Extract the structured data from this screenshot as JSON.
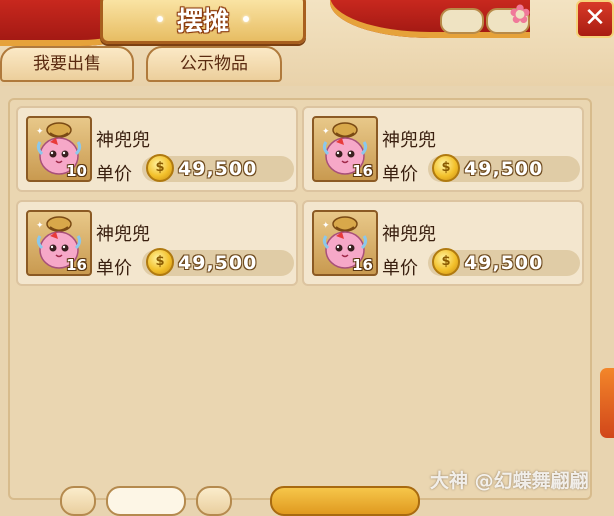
{
  "window": {
    "title": "摆摊",
    "close_icon": "close-icon",
    "accent_color": "#c8281e"
  },
  "tabs": [
    {
      "label": "我要出售"
    },
    {
      "label": "公示物品"
    }
  ],
  "items": [
    {
      "name": "神兜兜",
      "price_label": "单价",
      "price": "49,500",
      "count": "10",
      "icon": "bag-pet-icon"
    },
    {
      "name": "神兜兜",
      "price_label": "单价",
      "price": "49,500",
      "count": "16",
      "icon": "bag-pet-icon"
    },
    {
      "name": "神兜兜",
      "price_label": "单价",
      "price": "49,500",
      "count": "16",
      "icon": "bag-pet-icon"
    },
    {
      "name": "神兜兜",
      "price_label": "单价",
      "price": "49,500",
      "count": "16",
      "icon": "bag-pet-icon"
    }
  ],
  "watermark": "大神 @幻蝶舞翩翩"
}
